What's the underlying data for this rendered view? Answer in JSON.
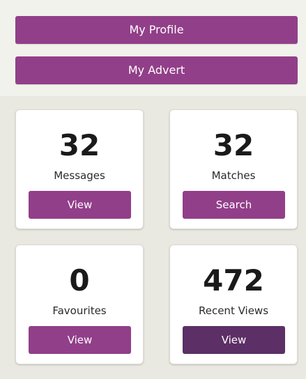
{
  "top_buttons": {
    "profile": "My Profile",
    "advert": "My Advert"
  },
  "cards": [
    {
      "count": "32",
      "label": "Messages",
      "button": "View"
    },
    {
      "count": "32",
      "label": "Matches",
      "button": "Search"
    },
    {
      "count": "0",
      "label": "Favourites",
      "button": "View"
    },
    {
      "count": "472",
      "label": "Recent Views",
      "button": "View"
    }
  ],
  "colors": {
    "brand_purple": "#923f89",
    "active_purple": "#5c2f66",
    "background": "#e9e8e1",
    "card": "#ffffff"
  }
}
